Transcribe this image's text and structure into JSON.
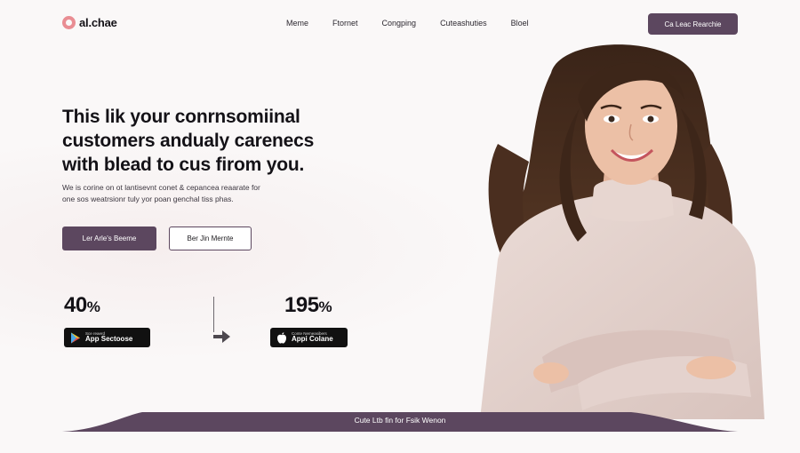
{
  "brand": {
    "name": "al.chae",
    "accent": "#5c475f",
    "logo_color": "#e98d93"
  },
  "nav": {
    "items": [
      {
        "label": "Meme"
      },
      {
        "label": "Ftornet"
      },
      {
        "label": "Congping"
      },
      {
        "label": "Cuteashuties"
      },
      {
        "label": "Bloel"
      }
    ],
    "cta_label": "Ca Leac Rearchie"
  },
  "hero": {
    "title_lines": [
      "This lik your conrnsomiinal",
      "customers andualy carenecs",
      "with blead to cus firom you."
    ],
    "subtitle_lines": [
      "We is corine on ot lantisevnt conet & cepancea reaarate for",
      "one sos weatrsionr tuly yor poan genchal tiss phas."
    ],
    "primary_button": "Ler Arle's Beeme",
    "secondary_button": "Ber Jin Mernte"
  },
  "stats": {
    "left": {
      "value": "40",
      "unit": "%"
    },
    "right": {
      "value": "195",
      "unit": "%"
    }
  },
  "badges": {
    "play": {
      "small": "Sce reaerd",
      "big": "App Sectoose",
      "icon": "play-store-icon"
    },
    "apple": {
      "small": "Conte Nemeasibers",
      "big": "Appi Colane",
      "icon": "apple-icon"
    }
  },
  "footer": {
    "bar_label": "Cute Ltb fin for Fsik Wenon"
  }
}
